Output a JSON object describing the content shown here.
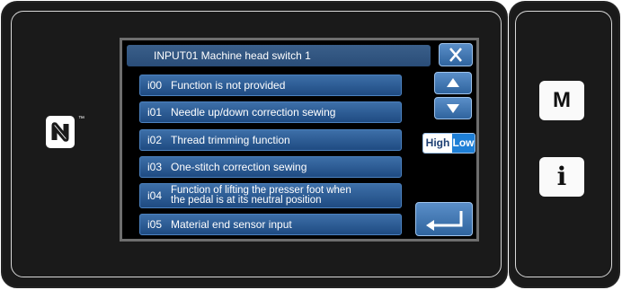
{
  "screen": {
    "title": "INPUT01  Machine head switch 1",
    "items": [
      {
        "code": "i00",
        "label": "Function is not provided"
      },
      {
        "code": "i01",
        "label": "Needle up/down correction sewing"
      },
      {
        "code": "i02",
        "label": "Thread trimming function"
      },
      {
        "code": "i03",
        "label": "One-stitch correction sewing"
      },
      {
        "code": "i04",
        "label": "Function of lifting the presser foot when\nthe pedal is at its neutral position"
      },
      {
        "code": "i05",
        "label": "Material end sensor  input"
      }
    ],
    "toggle": {
      "high_label": "High",
      "low_label": "Low",
      "selected": "Low"
    }
  },
  "side_keys": {
    "m_label": "M",
    "info_label": "i"
  },
  "nfc": {
    "trademark": "™"
  },
  "colors": {
    "button_blue": "#2f649e",
    "accent_low": "#1e7fd6",
    "bezel": "#1a1a1a"
  },
  "icons": [
    "close-icon",
    "arrow-up-icon",
    "arrow-down-icon",
    "enter-icon",
    "nfc-logo-icon"
  ]
}
